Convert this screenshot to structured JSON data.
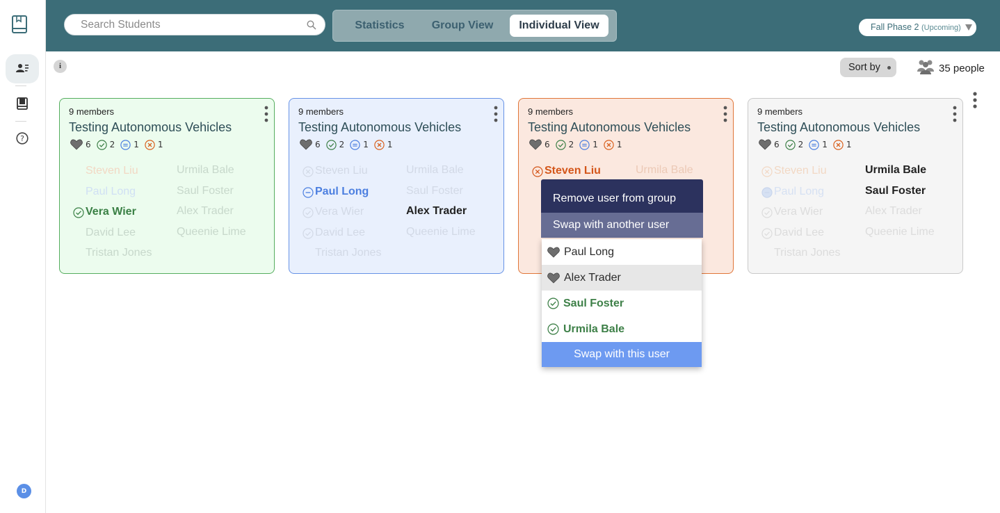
{
  "search": {
    "placeholder": "Search Students",
    "value": ""
  },
  "tabs": [
    {
      "label": "Statistics"
    },
    {
      "label": "Group View"
    },
    {
      "label": "Individual View"
    }
  ],
  "phase": {
    "label": "Fall Phase 2",
    "sub": "(Upcoming)"
  },
  "sidebar": {
    "avatar": "D"
  },
  "subbar": {
    "info": "i",
    "sort_label": "Sort by",
    "people_count": "35 people"
  },
  "groups": [
    {
      "members_count": "9 members",
      "title": "Testing Autonomous Vehicles",
      "stats": {
        "heart": "6",
        "check": "2",
        "neutral": "1",
        "cross": "1"
      },
      "members": [
        "Steven Liu",
        "Urmila Bale",
        "Paul Long",
        "Saul Foster",
        "Vera Wier",
        "Alex Trader",
        "David Lee",
        "Queenie Lime",
        "Tristan Jones"
      ]
    },
    {
      "members_count": "9 members",
      "title": "Testing Autonomous Vehicles",
      "stats": {
        "heart": "6",
        "check": "2",
        "neutral": "1",
        "cross": "1"
      },
      "members": [
        "Steven Liu",
        "Urmila Bale",
        "Paul Long",
        "Saul Foster",
        "Vera Wier",
        "Alex Trader",
        "David Lee",
        "Queenie Lime",
        "Tristan Jones"
      ]
    },
    {
      "members_count": "9 members",
      "title": "Testing Autonomous Vehicles",
      "stats": {
        "heart": "6",
        "check": "2",
        "neutral": "1",
        "cross": "1"
      },
      "members": [
        "Steven Liu",
        "Urmila Bale"
      ]
    },
    {
      "members_count": "9 members",
      "title": "Testing Autonomous Vehicles",
      "stats": {
        "heart": "6",
        "check": "2",
        "neutral": "1",
        "cross": "1"
      },
      "members": [
        "Steven Liu",
        "Urmila Bale",
        "Paul Long",
        "Saul Foster",
        "Vera Wier",
        "Alex Trader",
        "David Lee",
        "Queenie Lime",
        "Tristan Jones"
      ]
    }
  ],
  "menu": {
    "remove_label": "Remove user from group",
    "swap_label": "Swap with another user",
    "options": [
      "Paul Long",
      "Alex Trader",
      "Saul Foster",
      "Urmila Bale"
    ],
    "confirm_label": "Swap with this user"
  },
  "colors": {
    "header": "#3c6d78",
    "green": "#55ad5e",
    "blue": "#6692e6",
    "orange": "#e07538",
    "menu": "#2c325e",
    "confirm": "#6d9af1"
  }
}
